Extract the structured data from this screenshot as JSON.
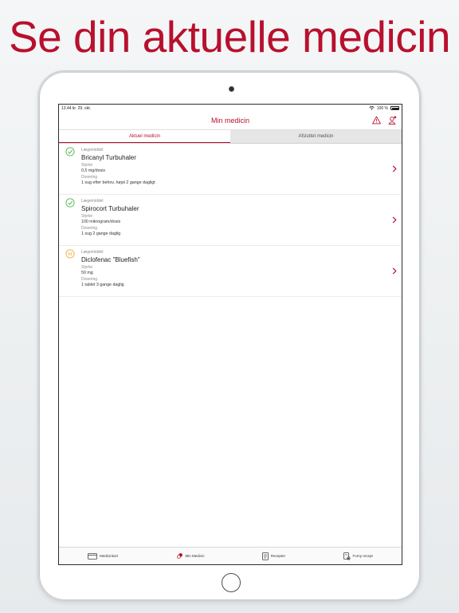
{
  "headline": "Se din aktuelle medicin",
  "status_bar": {
    "time_date": "13.44  tir. 29. okt.",
    "battery": "100 %"
  },
  "nav": {
    "title": "Min medicin",
    "icons": [
      "warning-icon",
      "user-alert-icon"
    ]
  },
  "tabs": [
    {
      "label": "Aktuel medicin",
      "active": true
    },
    {
      "label": "Afsluttet medicin",
      "active": false
    }
  ],
  "medicines": [
    {
      "type_label": "Lægemiddel",
      "name": "Bricanyl Turbuhaler",
      "strength_label": "Styrke",
      "strength": "0,5 mg/dosis",
      "dosage_label": "Dosering",
      "dosage": "1 sug efter behov, højst 2 gange dagligt",
      "status": "active",
      "status_icon": "check-circle-icon"
    },
    {
      "type_label": "Lægemiddel",
      "name": "Spirocort Turbuhaler",
      "strength_label": "Styrke",
      "strength": "100 mikrogram/dosis",
      "dosage_label": "Dosering",
      "dosage": "1 sug 2 gange daglig",
      "status": "active",
      "status_icon": "check-circle-icon"
    },
    {
      "type_label": "Lægemiddel",
      "name": "Diclofenac \"Bluefish\"",
      "strength_label": "Styrke",
      "strength": "50 mg",
      "dosage_label": "Dosering",
      "dosage": "1 tablet 3 gange daglig",
      "status": "paused",
      "status_icon": "pause-circle-icon"
    }
  ],
  "tabbar": [
    {
      "label": "Medicinkort",
      "icon": "card-icon",
      "active": false
    },
    {
      "label": "Min Medicin",
      "icon": "pill-icon",
      "active": true
    },
    {
      "label": "Recepter",
      "icon": "document-icon",
      "active": false
    },
    {
      "label": "Forny recept",
      "icon": "renew-prescription-icon",
      "active": false
    }
  ],
  "colors": {
    "brand": "#b8102e",
    "active_green": "#3aaa35",
    "paused_orange": "#f0a020"
  }
}
